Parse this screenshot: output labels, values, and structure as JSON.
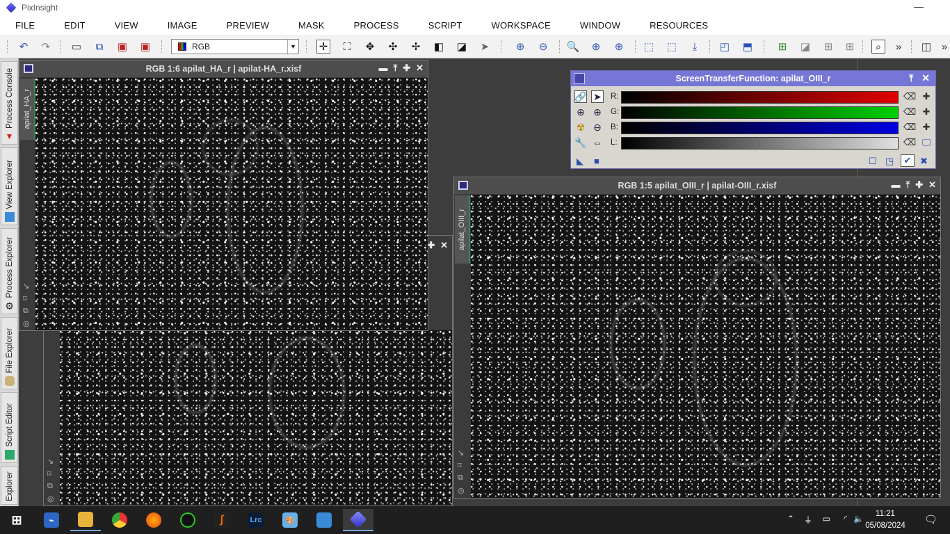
{
  "app": {
    "title": "PixInsight",
    "minimize": "—"
  },
  "menu": [
    "FILE",
    "EDIT",
    "VIEW",
    "IMAGE",
    "PREVIEW",
    "MASK",
    "PROCESS",
    "SCRIPT",
    "WORKSPACE",
    "WINDOW",
    "RESOURCES"
  ],
  "toolbar": {
    "channel_select": "RGB",
    "overflow": "»"
  },
  "sidebar": {
    "tabs": [
      "Process Console",
      "View Explorer",
      "Process Explorer",
      "File Explorer",
      "Script Editor",
      "Explorer"
    ]
  },
  "windows": {
    "ha": {
      "title": "RGB 1:6 apilat_HA_r | apilat-HA_r.xisf",
      "tab": "apilat_HA_r"
    },
    "oiii": {
      "title": "RGB 1:5 apilat_OIII_r | apilat-OIII_r.xisf",
      "tab": "apilat_OIII_r"
    },
    "buttons": [
      "▬",
      "⤒",
      "✚",
      "✕"
    ]
  },
  "stf": {
    "title": "ScreenTransferFunction: apilat_OIII_r",
    "channels": [
      {
        "label": "R:",
        "color": "#e00000"
      },
      {
        "label": "G:",
        "color": "#00d000"
      },
      {
        "label": "B:",
        "color": "#0000e0"
      },
      {
        "label": "L:",
        "color": "#e0e0e0"
      }
    ]
  },
  "taskbar": {
    "time": "11:21",
    "date": "05/08/2024",
    "lightroom_label": "Lrc"
  }
}
